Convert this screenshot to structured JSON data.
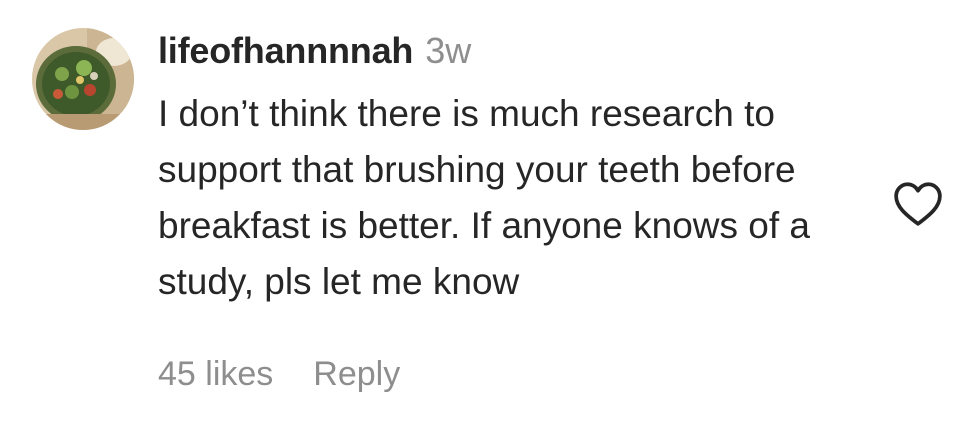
{
  "comment": {
    "username": "lifeofhannnnah",
    "timestamp": "3w",
    "text": "I don’t think there is much research to support that brushing your teeth before breakfast is better. If anyone knows of a study, pls let me know",
    "likes": "45 likes",
    "reply_label": "Reply"
  },
  "icons": {
    "avatar": "avatar-salad-bowl",
    "like": "heart-outline-icon"
  },
  "colors": {
    "primary_text": "#262626",
    "secondary_text": "#8e8e8e",
    "background": "#ffffff"
  }
}
